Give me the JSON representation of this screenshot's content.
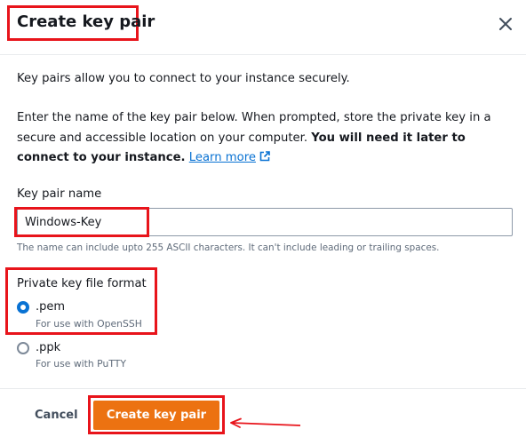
{
  "header": {
    "title": "Create key pair",
    "close_icon": "close-icon"
  },
  "body": {
    "intro": "Key pairs allow you to connect to your instance securely.",
    "instructions": "Enter the name of the key pair below. When prompted, store the private key in a secure and accessible location on your computer.",
    "instructions_bold": "You will need it later to connect to your instance.",
    "learn_more": "Learn more",
    "learn_more_icon": "external-link-icon"
  },
  "name_field": {
    "label": "Key pair name",
    "value": "Windows-Key",
    "hint": "The name can include upto 255 ASCII characters. It can't include leading or trailing spaces."
  },
  "format": {
    "label": "Private key file format",
    "options": [
      {
        "label": ".pem",
        "description": "For use with OpenSSH",
        "selected": true
      },
      {
        "label": ".ppk",
        "description": "For use with PuTTY",
        "selected": false
      }
    ]
  },
  "footer": {
    "cancel_label": "Cancel",
    "submit_label": "Create key pair"
  },
  "colors": {
    "primary": "#ec7211",
    "link": "#0972d3",
    "annotation": "#e8141b"
  }
}
